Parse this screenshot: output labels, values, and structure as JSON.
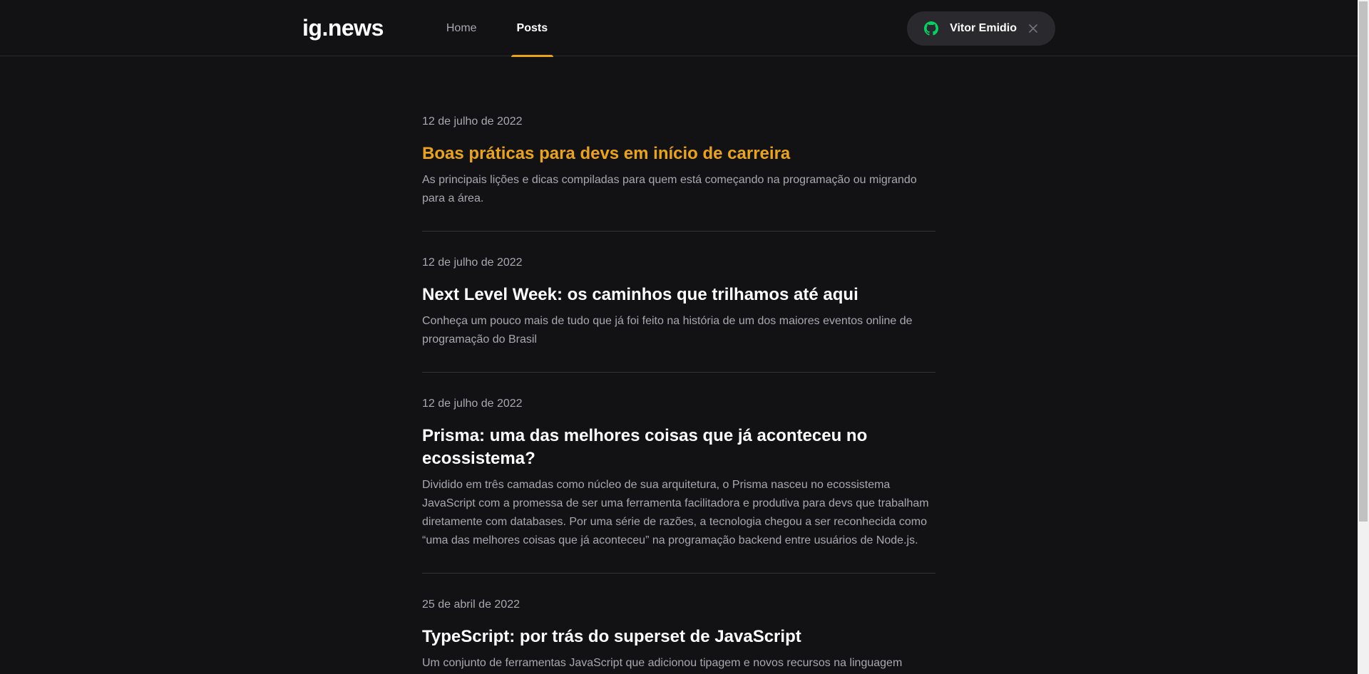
{
  "header": {
    "logo": "ig.news",
    "nav": [
      {
        "label": "Home",
        "active": false
      },
      {
        "label": "Posts",
        "active": true
      }
    ],
    "signin": {
      "user_name": "Vitor Emidio",
      "github_icon": "github-icon",
      "close_icon": "close-icon",
      "icon_color": "#04d361"
    }
  },
  "colors": {
    "background": "#121214",
    "accent": "#eba417",
    "text_muted": "#a8a8b3"
  },
  "posts": [
    {
      "date": "12 de julho de 2022",
      "title": "Boas práticas para devs em início de carreira",
      "excerpt": "As principais lições e dicas compiladas para quem está começando na programação ou migrando para a área."
    },
    {
      "date": "12 de julho de 2022",
      "title": "Next Level Week: os caminhos que trilhamos até aqui",
      "excerpt": "Conheça um pouco mais de tudo que já foi feito na história de um dos maiores eventos online de programação do Brasil"
    },
    {
      "date": "12 de julho de 2022",
      "title": "Prisma: uma das melhores coisas que já aconteceu no ecossistema?",
      "excerpt": "Dividido em três camadas como núcleo de sua arquitetura, o Prisma nasceu no ecossistema JavaScript com a promessa de ser uma ferramenta facilitadora e produtiva para devs que trabalham diretamente com databases. Por uma série de razões, a tecnologia chegou a ser reconhecida como “uma das melhores coisas que já aconteceu” na programação backend entre usuários de Node.js."
    },
    {
      "date": "25 de abril de 2022",
      "title": "TypeScript: por trás do superset de JavaScript",
      "excerpt": "Um conjunto de ferramentas JavaScript que adicionou tipagem e novos recursos na linguagem"
    }
  ]
}
